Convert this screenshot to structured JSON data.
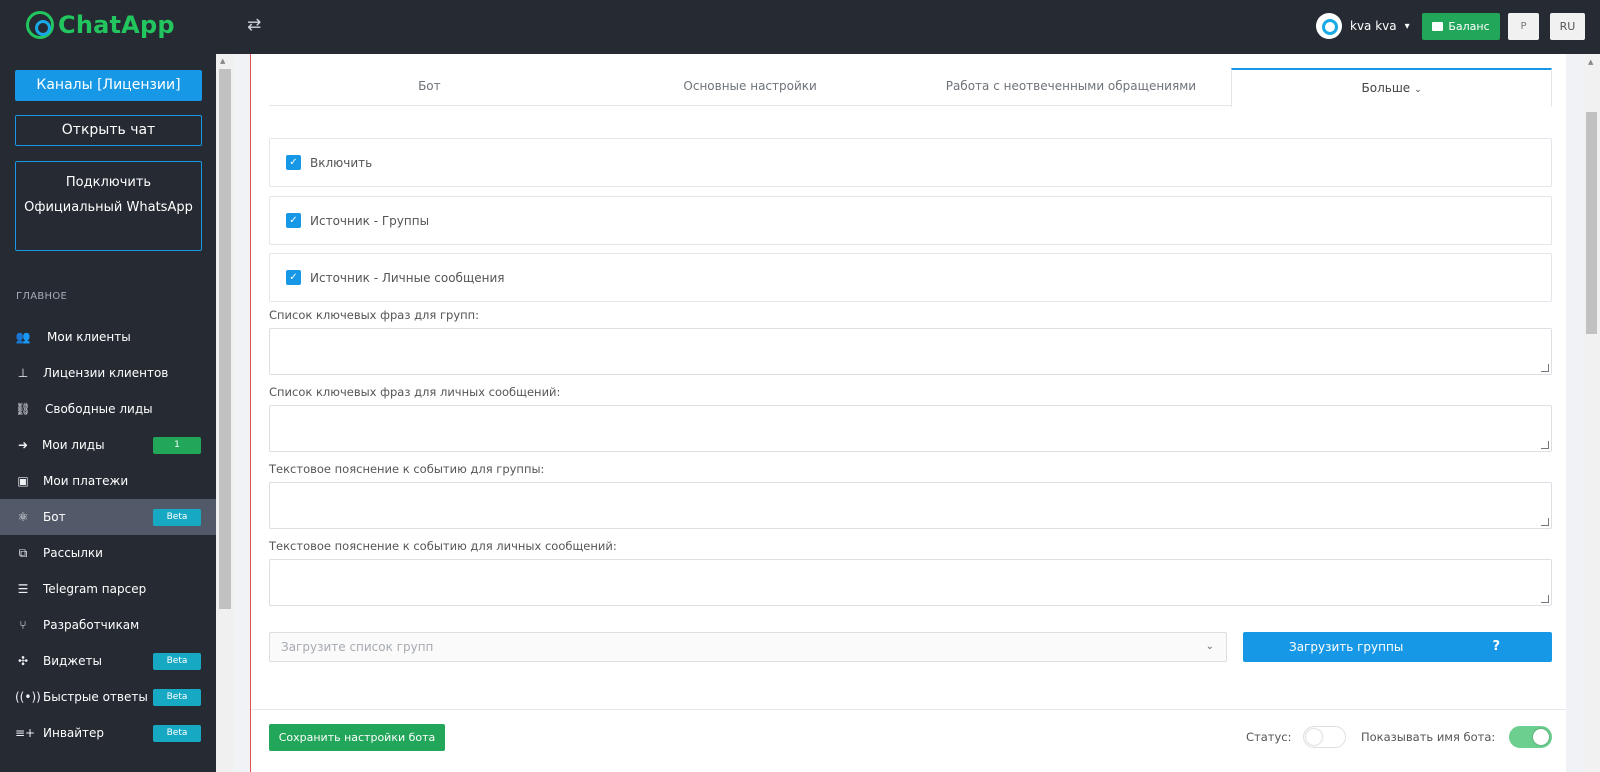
{
  "app": {
    "logo_text": "ChatApp"
  },
  "header": {
    "user_name": "kva kva",
    "balance_label": "Баланс",
    "p_label": "P",
    "lang_label": "RU"
  },
  "sidebar": {
    "channels_button": "Каналы [Лицензии]",
    "open_chat_button": "Открыть чат",
    "connect_line1": "Подключить",
    "connect_line2": "Официальный WhatsApp",
    "section_label": "ГЛАВНОЕ",
    "items": [
      {
        "label": "Мои клиенты",
        "icon": "users-icon"
      },
      {
        "label": "Лицензии клиентов",
        "icon": "stamp-icon"
      },
      {
        "label": "Свободные лиды",
        "icon": "network-icon"
      },
      {
        "label": "Мои лиды",
        "icon": "sign-in-icon",
        "badge": "1"
      },
      {
        "label": "Мои платежи",
        "icon": "store-icon"
      },
      {
        "label": "Бот",
        "icon": "atom-icon",
        "badge": "Beta"
      },
      {
        "label": "Рассылки",
        "icon": "broadcast-icon"
      },
      {
        "label": "Telegram парсер",
        "icon": "list-icon"
      },
      {
        "label": "Разработчикам",
        "icon": "code-branch-icon"
      },
      {
        "label": "Виджеты",
        "icon": "fan-icon",
        "badge": "Beta"
      },
      {
        "label": "Быстрые ответы",
        "icon": "signal-icon",
        "badge": "Beta"
      },
      {
        "label": "Инвайтер",
        "icon": "list-plus-icon",
        "badge": "Beta"
      }
    ]
  },
  "tabs": [
    {
      "label": "Бот"
    },
    {
      "label": "Основные настройки"
    },
    {
      "label": "Работа с неотвеченными обращениями"
    },
    {
      "label": "Больше"
    }
  ],
  "form": {
    "checks": [
      {
        "label": "Включить",
        "checked": true
      },
      {
        "label": "Источник - Группы",
        "checked": true
      },
      {
        "label": "Источник - Личные сообщения",
        "checked": true
      }
    ],
    "fields": [
      {
        "label": "Список ключевых фраз для групп:",
        "value": ""
      },
      {
        "label": "Список ключевых фраз для личных сообщений:",
        "value": ""
      },
      {
        "label": "Текстовое пояснение к событию для группы:",
        "value": ""
      },
      {
        "label": "Текстовое пояснение к событию для личных сообщений:",
        "value": ""
      }
    ],
    "groups_select_placeholder": "Загрузите список групп",
    "load_groups_button": "Загрузить группы",
    "help_mark": "?"
  },
  "footer": {
    "save_button": "Сохранить настройки бота",
    "status_label": "Статус:",
    "status_on": false,
    "show_bot_name_label": "Показывать имя бота:",
    "show_bot_name_on": true
  },
  "colors": {
    "sidebar_bg": "#252a33",
    "accent_blue": "#1798e6",
    "success_green": "#22a65a",
    "beta_teal": "#17a9c4"
  }
}
